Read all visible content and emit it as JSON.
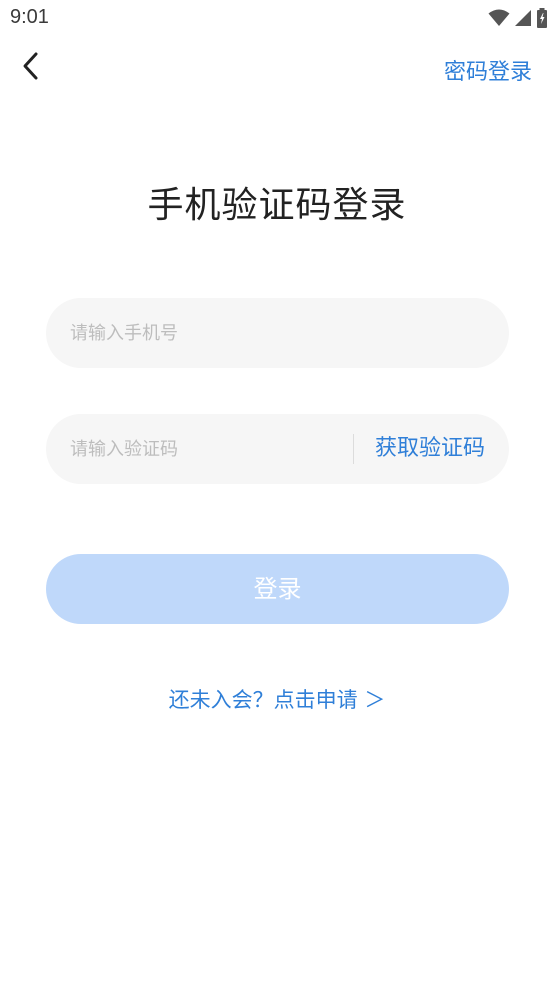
{
  "status_bar": {
    "time": "9:01",
    "icons": [
      "wifi-icon",
      "signal-icon",
      "battery-icon"
    ]
  },
  "nav": {
    "back_icon": "chevron-left-icon",
    "password_login_link": "密码登录"
  },
  "title": "手机验证码登录",
  "phone_input": {
    "placeholder": "请输入手机号",
    "value": ""
  },
  "code_input": {
    "placeholder": "请输入验证码",
    "value": ""
  },
  "get_code_button": "获取验证码",
  "login_button": "登录",
  "apply_link": "还未入会？点击申请 ＞",
  "colors": {
    "accent": "#2f7fd8",
    "login_button_disabled": "#bfd8fa",
    "field_background": "#f6f6f6",
    "placeholder": "#bdbdbd",
    "title": "#222222"
  }
}
